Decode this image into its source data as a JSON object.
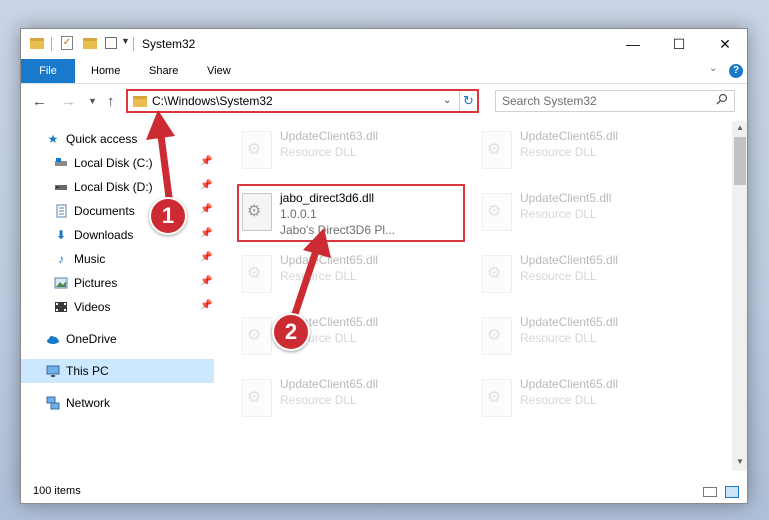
{
  "window": {
    "title": "System32",
    "controls": {
      "minimize": "—",
      "maximize": "☐",
      "close": "✕"
    }
  },
  "ribbon": {
    "tabs": [
      {
        "label": "File"
      },
      {
        "label": "Home"
      },
      {
        "label": "Share"
      },
      {
        "label": "View"
      }
    ],
    "help": "?"
  },
  "navigation": {
    "address": "C:\\Windows\\System32",
    "search_placeholder": "Search System32"
  },
  "sidebar": {
    "items": [
      {
        "label": "Quick access",
        "icon": "star-icon"
      },
      {
        "label": "Local Disk (C:)",
        "icon": "drive-icon",
        "pinned": true
      },
      {
        "label": "Local Disk (D:)",
        "icon": "drive-icon",
        "pinned": true
      },
      {
        "label": "Documents",
        "icon": "documents-icon",
        "pinned": true
      },
      {
        "label": "Downloads",
        "icon": "download-icon",
        "pinned": true
      },
      {
        "label": "Music",
        "icon": "music-icon",
        "pinned": true
      },
      {
        "label": "Pictures",
        "icon": "pictures-icon",
        "pinned": true
      },
      {
        "label": "Videos",
        "icon": "video-icon",
        "pinned": true
      },
      {
        "label": "OneDrive",
        "icon": "cloud-icon"
      },
      {
        "label": "This PC",
        "icon": "computer-icon",
        "selected": true
      },
      {
        "label": "Network",
        "icon": "network-icon"
      }
    ]
  },
  "files": [
    {
      "name": "UpdateClient63.dll",
      "type": "Resource DLL",
      "faded": true
    },
    {
      "name": "UpdateClient65.dll",
      "type": "Resource DLL",
      "faded": true
    },
    {
      "name": "jabo_direct3d6.dll",
      "version": "1.0.0.1",
      "description": "Jabo's Direct3D6 Pl...",
      "highlighted": true
    },
    {
      "name": "UpdateClient5.dll",
      "type": "Resource DLL",
      "faded": true
    },
    {
      "name": "UpdateClient65.dll",
      "type": "Resource DLL",
      "faded": true
    },
    {
      "name": "UpdateClient65.dll",
      "type": "Resource DLL",
      "faded": true
    },
    {
      "name": "UpdateClient65.dll",
      "type": "Resource DLL",
      "faded": true
    },
    {
      "name": "UpdateClient65.dll",
      "type": "Resource DLL",
      "faded": true
    },
    {
      "name": "UpdateClient65.dll",
      "type": "Resource DLL",
      "faded": true
    },
    {
      "name": "UpdateClient65.dll",
      "type": "Resource DLL",
      "faded": true
    }
  ],
  "status": {
    "item_count": "100 items"
  },
  "annotations": {
    "step1": "1",
    "step2": "2",
    "color": "#cc2b33"
  }
}
